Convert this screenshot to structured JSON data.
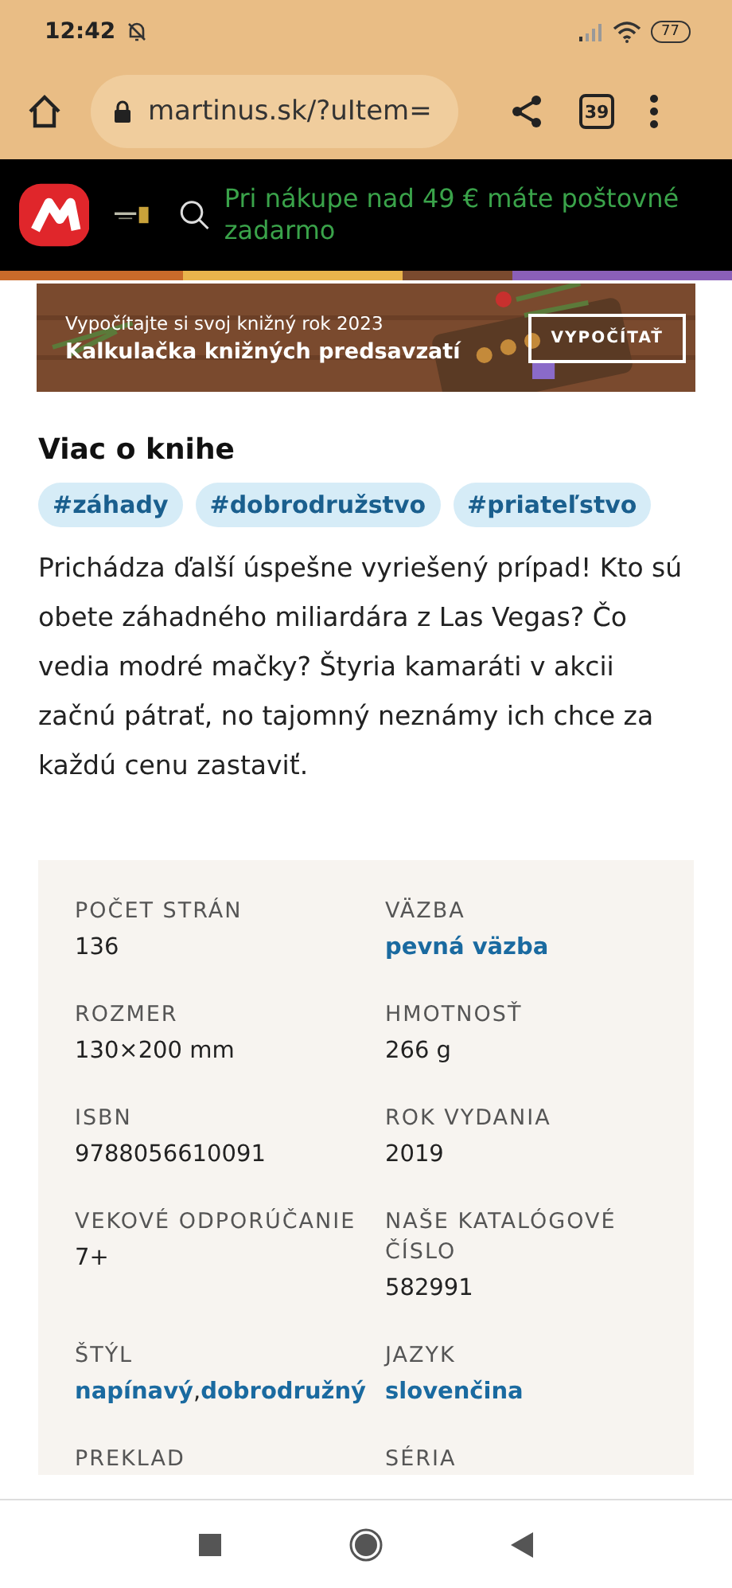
{
  "status_bar": {
    "time": "12:42",
    "battery": "77"
  },
  "browser": {
    "url": "martinus.sk/?uItem=",
    "tab_count": "39"
  },
  "header": {
    "promo": "Pri nákupe nad 49 € máte poštovné zadarmo"
  },
  "banner": {
    "subtitle": "Vypočítajte si svoj knižný rok 2023",
    "title": "Kalkulačka knižných predsavzatí",
    "button": "VYPOČÍTAŤ"
  },
  "section_title": "Viac o knihe",
  "tags": [
    "#záhady",
    "#dobrodružstvo",
    "#priateľstvo"
  ],
  "description": "Prichádza ďalší úspešne vyriešený prípad! Kto sú obete záhadného miliardára z Las Vegas? Čo vedia modré mačky? Štyria kamaráti v akcii začnú pátrať, no tajomný neznámy ich chce za každú cenu zastaviť.",
  "details": [
    {
      "label": "POČET STRÁN",
      "kind": "text",
      "values": [
        "136"
      ]
    },
    {
      "label": "VÄZBA",
      "kind": "link",
      "values": [
        "pevná väzba"
      ]
    },
    {
      "label": "ROZMER",
      "kind": "text",
      "values": [
        "130×200 mm"
      ]
    },
    {
      "label": "HMOTNOSŤ",
      "kind": "text",
      "values": [
        "266 g"
      ]
    },
    {
      "label": "ISBN",
      "kind": "text",
      "values": [
        "9788056610091"
      ]
    },
    {
      "label": "ROK VYDANIA",
      "kind": "text",
      "values": [
        "2019"
      ]
    },
    {
      "label": "VEKOVÉ ODPORÚČANIE",
      "kind": "text",
      "values": [
        "7+"
      ]
    },
    {
      "label": "NAŠE KATALÓGOVÉ ČÍSLO",
      "kind": "text",
      "values": [
        "582991"
      ]
    },
    {
      "label": "ŠTÝL",
      "kind": "link",
      "separator": ",",
      "values": [
        "napínavý",
        "dobrodružný"
      ]
    },
    {
      "label": "JAZYK",
      "kind": "link",
      "values": [
        "slovenčina"
      ]
    },
    {
      "label": "PREKLAD"
    },
    {
      "label": "SÉRIA"
    }
  ]
}
